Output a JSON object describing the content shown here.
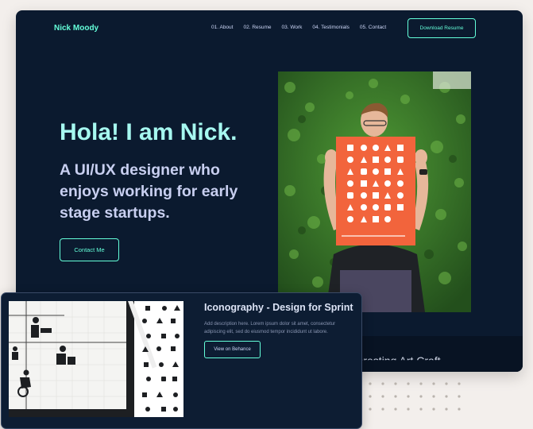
{
  "header": {
    "brand": "Nick Moody",
    "nav": [
      {
        "label": "01. About"
      },
      {
        "label": "02. Resume"
      },
      {
        "label": "03. Work"
      },
      {
        "label": "04. Testimonials"
      },
      {
        "label": "05. Contact"
      }
    ],
    "download_label": "Download Resume"
  },
  "hero": {
    "title": "Hola! I am Nick.",
    "subtitle": "A UI/UX designer who enjoys working for early stage startups.",
    "contact_label": "Contact Me"
  },
  "band": {
    "partial_heading": "Interesting Art Craft"
  },
  "project_card": {
    "title": "Iconography - Design for Sprint",
    "description": "Add description here. Lorem ipsum dolor sit amet, consectetur adipiscing elit, sed do eiusmod tempor incididunt ut labore.",
    "button_label": "View on Behance"
  },
  "colors": {
    "background": "#0b1a2f",
    "accent": "#64ffda",
    "title": "#a6f8f0",
    "text": "#c8cff0",
    "poster": "#f2643c"
  }
}
